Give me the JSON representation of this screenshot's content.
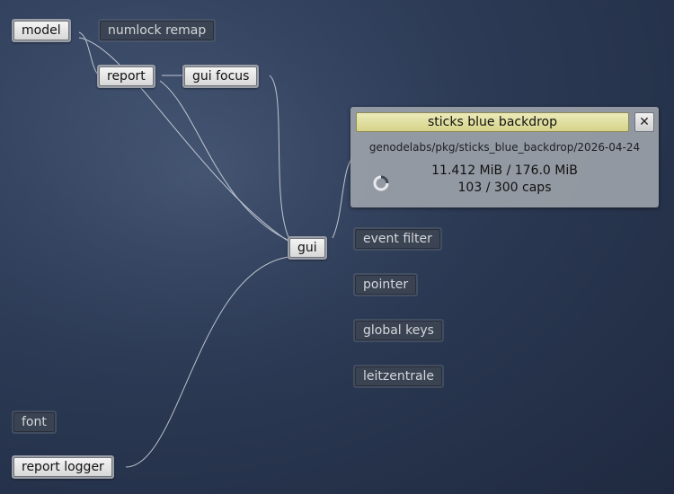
{
  "nodes": {
    "model": "model",
    "numlock_remap": "numlock remap",
    "report": "report",
    "gui_focus": "gui focus",
    "gui": "gui",
    "event_filter": "event filter",
    "pointer": "pointer",
    "global_keys": "global keys",
    "leitzentrale": "leitzentrale",
    "font": "font",
    "report_logger": "report logger"
  },
  "detail": {
    "title": "sticks blue backdrop",
    "close_label": "✕",
    "pkg_path": "genodelabs/pkg/sticks_blue_backdrop/2026-04-24",
    "ram": "11.412 MiB / 176.0 MiB",
    "caps": "103 / 300 caps",
    "spinner_icon": "busy-spinner-icon"
  },
  "colors": {
    "title_bar": "#e3e1a3",
    "active_node": "#f0f0f0",
    "passive_node": "#3a4250",
    "background": "#2c3a55",
    "link": "#d7dbe2"
  }
}
